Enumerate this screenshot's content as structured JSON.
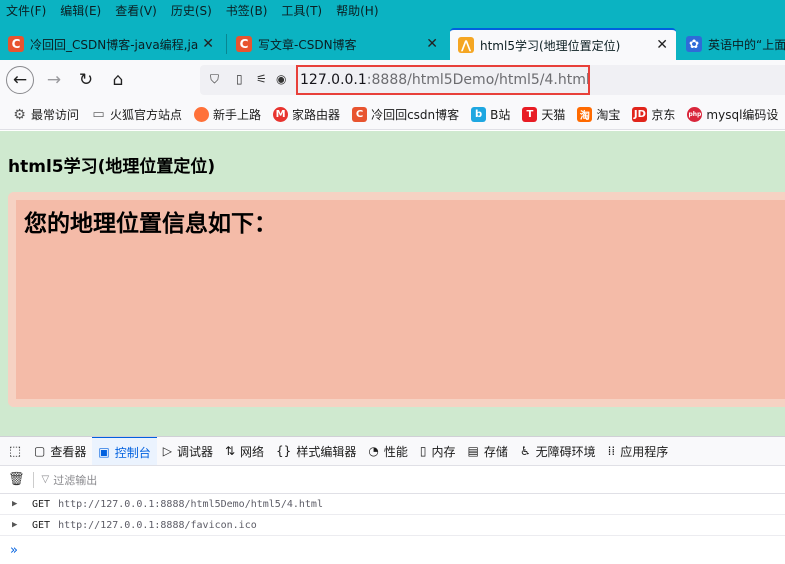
{
  "menubar": [
    "文件(F)",
    "编辑(E)",
    "查看(V)",
    "历史(S)",
    "书签(B)",
    "工具(T)",
    "帮助(H)"
  ],
  "tabs": [
    {
      "label": "冷回回_CSDN博客-java编程,ja",
      "icon": "csdn-icon"
    },
    {
      "label": "写文章-CSDN博客",
      "icon": "csdn-icon"
    },
    {
      "label": "html5学习(地理位置定位)",
      "icon": "html5-icon",
      "active": true
    },
    {
      "label": "英语中的“上面”",
      "icon": "baidu-icon"
    }
  ],
  "close_glyph": "✕",
  "nav": {
    "back": "←",
    "forward": "→",
    "reload": "↻",
    "home": "⌂"
  },
  "url": {
    "host": "127.0.0.1",
    "rest": ":8888/html5Demo/html5/4.html"
  },
  "bookmarks": [
    {
      "label": "最常访问",
      "icon": "gear-icon",
      "color": "#555555"
    },
    {
      "label": "火狐官方站点",
      "icon": "folder-icon",
      "color": "#8a8a8e"
    },
    {
      "label": "新手上路",
      "icon": "firefox-icon",
      "color": "#ff7139"
    },
    {
      "label": "家路由器",
      "icon": "router-icon",
      "color": "#e8342f"
    },
    {
      "label": "冷回回csdn博客",
      "icon": "csdn-icon",
      "color": "#e8542f"
    },
    {
      "label": "B站",
      "icon": "bilibili-icon",
      "color": "#1ea7e1"
    },
    {
      "label": "天猫",
      "icon": "tmall-icon",
      "color": "#e81c24"
    },
    {
      "label": "淘宝",
      "icon": "taobao-icon",
      "color": "#ff6a00"
    },
    {
      "label": "京东",
      "icon": "jd-icon",
      "color": "#e1251b"
    },
    {
      "label": "mysql编码设",
      "icon": "php-icon",
      "color": "#d9263b"
    }
  ],
  "page": {
    "title": "html5学习(地理位置定位)",
    "geo_heading": "您的地理位置信息如下："
  },
  "devtools": {
    "tabs": [
      {
        "label": "查看器",
        "icon": "inspector-icon",
        "glyph": "▢"
      },
      {
        "label": "控制台",
        "icon": "console-icon",
        "glyph": "▣",
        "active": true
      },
      {
        "label": "调试器",
        "icon": "debugger-icon",
        "glyph": "▷"
      },
      {
        "label": "网络",
        "icon": "network-icon",
        "glyph": "⇅"
      },
      {
        "label": "样式编辑器",
        "icon": "style-editor-icon",
        "glyph": "{}"
      },
      {
        "label": "性能",
        "icon": "performance-icon",
        "glyph": "◔"
      },
      {
        "label": "内存",
        "icon": "memory-icon",
        "glyph": "▯"
      },
      {
        "label": "存储",
        "icon": "storage-icon",
        "glyph": "▤"
      },
      {
        "label": "无障碍环境",
        "icon": "accessibility-icon",
        "glyph": "♿"
      },
      {
        "label": "应用程序",
        "icon": "application-icon",
        "glyph": "⁞⁞"
      }
    ],
    "filter_placeholder": "过滤输出",
    "logs": [
      {
        "method": "GET",
        "url": "http://127.0.0.1:8888/html5Demo/html5/4.html"
      },
      {
        "method": "GET",
        "url": "http://127.0.0.1:8888/favicon.ico"
      }
    ],
    "prompt": "»"
  },
  "colors": {
    "chrome_teal": "#0bb3c2",
    "page_bg": "#cfe9cf",
    "geo_box_bg": "#f4bba8",
    "geo_box_border": "#f6d2c3",
    "url_highlight": "#e8403a",
    "accent": "#0060df"
  }
}
